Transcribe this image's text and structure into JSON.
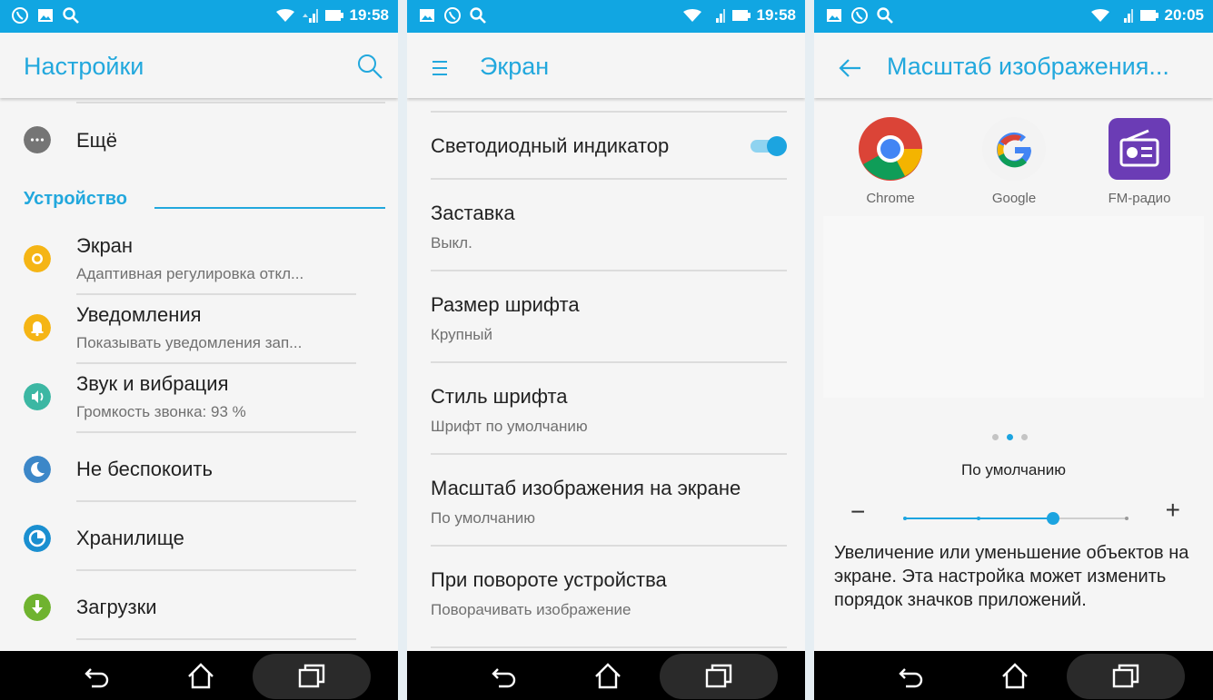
{
  "colors": {
    "status_bar": "#11a6e2",
    "accent": "#22a8dd",
    "background": "#f5f5f5",
    "nav_bar": "#000000"
  },
  "status_bars": [
    {
      "time": "19:58",
      "left_icons": [
        "viber-icon",
        "image-icon",
        "search-icon"
      ]
    },
    {
      "time": "19:58",
      "left_icons": [
        "image-icon",
        "viber-icon",
        "search-icon"
      ]
    },
    {
      "time": "20:05",
      "left_icons": [
        "image-icon",
        "viber-icon",
        "search-icon"
      ]
    }
  ],
  "settings_screen": {
    "title": "Настройки",
    "more_item": {
      "label": "Ещё",
      "icon": "more-dots-icon",
      "icon_color": "#757575"
    },
    "category": "Устройство",
    "items": [
      {
        "label": "Экран",
        "summary": "Адаптивная регулировка откл...",
        "icon": "display-icon",
        "icon_color": "#f5b515"
      },
      {
        "label": "Уведомления",
        "summary": "Показывать уведомления зап...",
        "icon": "bell-icon",
        "icon_color": "#f5b515"
      },
      {
        "label": "Звук и вибрация",
        "summary": "Громкость звонка: 93 %",
        "icon": "volume-icon",
        "icon_color": "#3cb7a3"
      },
      {
        "label": "Не беспокоить",
        "summary": "",
        "icon": "moon-icon",
        "icon_color": "#3c87c8"
      },
      {
        "label": "Хранилище",
        "summary": "",
        "icon": "storage-icon",
        "icon_color": "#1a8fd0"
      },
      {
        "label": "Загрузки",
        "summary": "",
        "icon": "download-icon",
        "icon_color": "#6fb32f"
      }
    ]
  },
  "display_screen": {
    "title": "Экран",
    "items": [
      {
        "label": "Светодиодный индикатор",
        "summary": "",
        "toggle": true
      },
      {
        "label": "Заставка",
        "summary": "Выкл."
      },
      {
        "label": "Размер шрифта",
        "summary": "Крупный"
      },
      {
        "label": "Стиль шрифта",
        "summary": "Шрифт по умолчанию"
      },
      {
        "label": "Масштаб изображения на экране",
        "summary": "По умолчанию"
      },
      {
        "label": "При повороте устройства",
        "summary": "Поворачивать изображение"
      }
    ]
  },
  "scale_screen": {
    "title": "Масштаб изображения...",
    "apps": [
      {
        "label": "Chrome",
        "icon": "chrome-icon"
      },
      {
        "label": "Google",
        "icon": "google-icon"
      },
      {
        "label": "FM-радио",
        "icon": "fm-radio-icon"
      }
    ],
    "page_count": 3,
    "current_page": 2,
    "scale_label": "По умолчанию",
    "minus": "−",
    "plus": "+",
    "slider": {
      "steps": 4,
      "selected_index": 2
    },
    "description": "Увеличение или уменьшение объектов на экране. Эта настройка может изменить порядок значков приложений."
  }
}
